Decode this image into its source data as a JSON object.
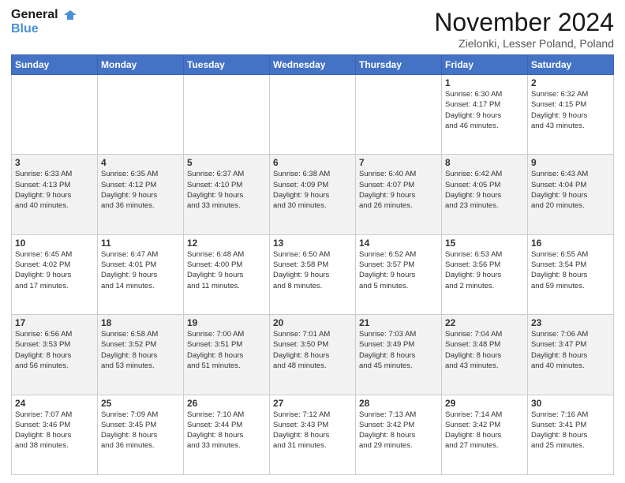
{
  "header": {
    "logo_line1": "General",
    "logo_line2": "Blue",
    "month": "November 2024",
    "location": "Zielonki, Lesser Poland, Poland"
  },
  "days_of_week": [
    "Sunday",
    "Monday",
    "Tuesday",
    "Wednesday",
    "Thursday",
    "Friday",
    "Saturday"
  ],
  "weeks": [
    [
      {
        "num": "",
        "info": ""
      },
      {
        "num": "",
        "info": ""
      },
      {
        "num": "",
        "info": ""
      },
      {
        "num": "",
        "info": ""
      },
      {
        "num": "",
        "info": ""
      },
      {
        "num": "1",
        "info": "Sunrise: 6:30 AM\nSunset: 4:17 PM\nDaylight: 9 hours\nand 46 minutes."
      },
      {
        "num": "2",
        "info": "Sunrise: 6:32 AM\nSunset: 4:15 PM\nDaylight: 9 hours\nand 43 minutes."
      }
    ],
    [
      {
        "num": "3",
        "info": "Sunrise: 6:33 AM\nSunset: 4:13 PM\nDaylight: 9 hours\nand 40 minutes."
      },
      {
        "num": "4",
        "info": "Sunrise: 6:35 AM\nSunset: 4:12 PM\nDaylight: 9 hours\nand 36 minutes."
      },
      {
        "num": "5",
        "info": "Sunrise: 6:37 AM\nSunset: 4:10 PM\nDaylight: 9 hours\nand 33 minutes."
      },
      {
        "num": "6",
        "info": "Sunrise: 6:38 AM\nSunset: 4:09 PM\nDaylight: 9 hours\nand 30 minutes."
      },
      {
        "num": "7",
        "info": "Sunrise: 6:40 AM\nSunset: 4:07 PM\nDaylight: 9 hours\nand 26 minutes."
      },
      {
        "num": "8",
        "info": "Sunrise: 6:42 AM\nSunset: 4:05 PM\nDaylight: 9 hours\nand 23 minutes."
      },
      {
        "num": "9",
        "info": "Sunrise: 6:43 AM\nSunset: 4:04 PM\nDaylight: 9 hours\nand 20 minutes."
      }
    ],
    [
      {
        "num": "10",
        "info": "Sunrise: 6:45 AM\nSunset: 4:02 PM\nDaylight: 9 hours\nand 17 minutes."
      },
      {
        "num": "11",
        "info": "Sunrise: 6:47 AM\nSunset: 4:01 PM\nDaylight: 9 hours\nand 14 minutes."
      },
      {
        "num": "12",
        "info": "Sunrise: 6:48 AM\nSunset: 4:00 PM\nDaylight: 9 hours\nand 11 minutes."
      },
      {
        "num": "13",
        "info": "Sunrise: 6:50 AM\nSunset: 3:58 PM\nDaylight: 9 hours\nand 8 minutes."
      },
      {
        "num": "14",
        "info": "Sunrise: 6:52 AM\nSunset: 3:57 PM\nDaylight: 9 hours\nand 5 minutes."
      },
      {
        "num": "15",
        "info": "Sunrise: 6:53 AM\nSunset: 3:56 PM\nDaylight: 9 hours\nand 2 minutes."
      },
      {
        "num": "16",
        "info": "Sunrise: 6:55 AM\nSunset: 3:54 PM\nDaylight: 8 hours\nand 59 minutes."
      }
    ],
    [
      {
        "num": "17",
        "info": "Sunrise: 6:56 AM\nSunset: 3:53 PM\nDaylight: 8 hours\nand 56 minutes."
      },
      {
        "num": "18",
        "info": "Sunrise: 6:58 AM\nSunset: 3:52 PM\nDaylight: 8 hours\nand 53 minutes."
      },
      {
        "num": "19",
        "info": "Sunrise: 7:00 AM\nSunset: 3:51 PM\nDaylight: 8 hours\nand 51 minutes."
      },
      {
        "num": "20",
        "info": "Sunrise: 7:01 AM\nSunset: 3:50 PM\nDaylight: 8 hours\nand 48 minutes."
      },
      {
        "num": "21",
        "info": "Sunrise: 7:03 AM\nSunset: 3:49 PM\nDaylight: 8 hours\nand 45 minutes."
      },
      {
        "num": "22",
        "info": "Sunrise: 7:04 AM\nSunset: 3:48 PM\nDaylight: 8 hours\nand 43 minutes."
      },
      {
        "num": "23",
        "info": "Sunrise: 7:06 AM\nSunset: 3:47 PM\nDaylight: 8 hours\nand 40 minutes."
      }
    ],
    [
      {
        "num": "24",
        "info": "Sunrise: 7:07 AM\nSunset: 3:46 PM\nDaylight: 8 hours\nand 38 minutes."
      },
      {
        "num": "25",
        "info": "Sunrise: 7:09 AM\nSunset: 3:45 PM\nDaylight: 8 hours\nand 36 minutes."
      },
      {
        "num": "26",
        "info": "Sunrise: 7:10 AM\nSunset: 3:44 PM\nDaylight: 8 hours\nand 33 minutes."
      },
      {
        "num": "27",
        "info": "Sunrise: 7:12 AM\nSunset: 3:43 PM\nDaylight: 8 hours\nand 31 minutes."
      },
      {
        "num": "28",
        "info": "Sunrise: 7:13 AM\nSunset: 3:42 PM\nDaylight: 8 hours\nand 29 minutes."
      },
      {
        "num": "29",
        "info": "Sunrise: 7:14 AM\nSunset: 3:42 PM\nDaylight: 8 hours\nand 27 minutes."
      },
      {
        "num": "30",
        "info": "Sunrise: 7:16 AM\nSunset: 3:41 PM\nDaylight: 8 hours\nand 25 minutes."
      }
    ]
  ]
}
